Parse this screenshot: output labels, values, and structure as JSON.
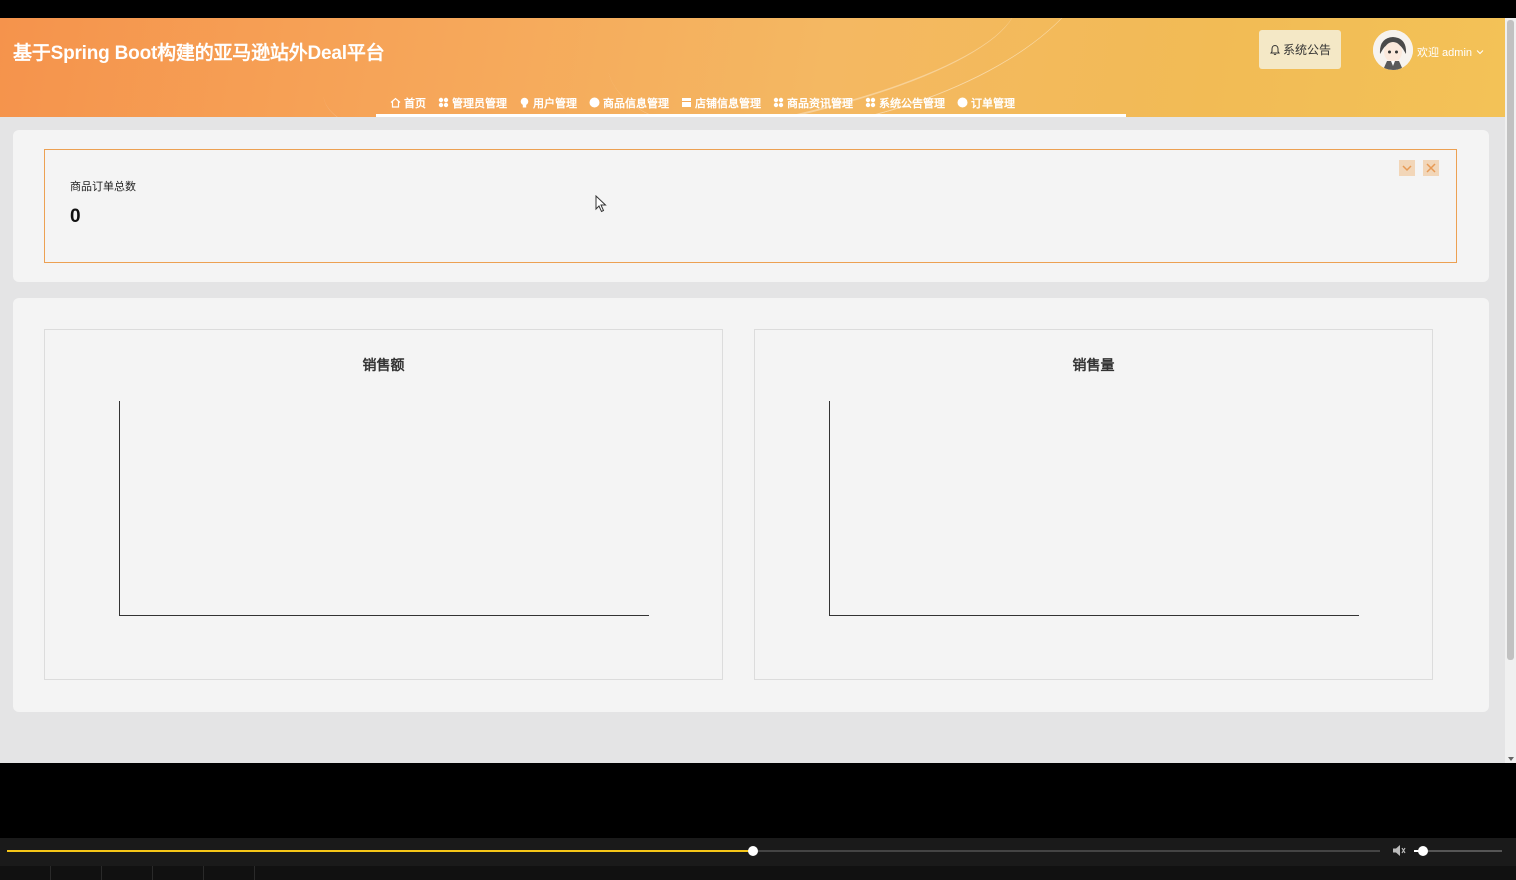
{
  "header": {
    "title": "基于Spring Boot构建的亚马逊站外Deal平台",
    "notice_label": "系统公告",
    "welcome_label": "欢迎 admin"
  },
  "nav": {
    "items": [
      {
        "label": "首页",
        "icon": "home-icon"
      },
      {
        "label": "管理员管理",
        "icon": "grid-icon"
      },
      {
        "label": "用户管理",
        "icon": "bulb-icon"
      },
      {
        "label": "商品信息管理",
        "icon": "circle-icon"
      },
      {
        "label": "店铺信息管理",
        "icon": "square-icon"
      },
      {
        "label": "商品资讯管理",
        "icon": "grid-icon"
      },
      {
        "label": "系统公告管理",
        "icon": "grid-icon"
      },
      {
        "label": "订单管理",
        "icon": "circle-icon"
      }
    ]
  },
  "stats": {
    "label": "商品订单总数",
    "value": "0"
  },
  "charts": {
    "left_title": "销售额",
    "right_title": "销售量"
  },
  "chart_data": [
    {
      "type": "line",
      "title": "销售额",
      "categories": [],
      "values": []
    },
    {
      "type": "line",
      "title": "销售量",
      "categories": [],
      "values": []
    }
  ],
  "player": {
    "progress": 0.543,
    "volume": 0.1
  },
  "colors": {
    "accent": "#eca052",
    "progress": "#f5c518"
  }
}
